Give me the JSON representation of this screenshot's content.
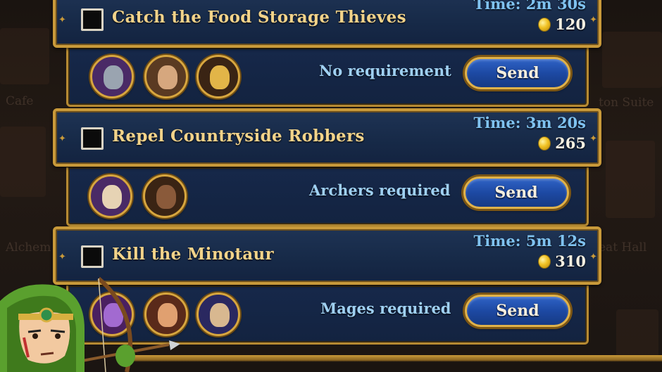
{
  "background": {
    "labels": [
      "Cafe",
      "Alchem",
      "ton Suite",
      "eat Hall"
    ]
  },
  "missions": [
    {
      "title": "Catch the Food Storage Thieves",
      "time": "Time: 2m 30s",
      "reward": "120",
      "requirement": "No requirement",
      "send_label": "Send",
      "heroes": [
        "knight-portrait",
        "warrior-portrait",
        "golden-helmet-portrait"
      ]
    },
    {
      "title": "Repel Countryside Robbers",
      "time": "Time: 3m 20s",
      "reward": "265",
      "requirement": "Archers required",
      "send_label": "Send",
      "heroes": [
        "elf-archer-portrait",
        "hooded-archer-portrait"
      ]
    },
    {
      "title": "Kill the Minotaur",
      "time": "Time: 5m 12s",
      "reward": "310",
      "requirement": "Mages required",
      "send_label": "Send",
      "heroes": [
        "purple-mage-portrait",
        "red-mage-portrait",
        "hooded-mage-portrait"
      ]
    }
  ],
  "colors": {
    "panel": "#172a48",
    "border_gold": "#c99a3a",
    "title_gold": "#f2d38a",
    "time_blue": "#7fc2f0",
    "button_blue": "#1d49a3"
  }
}
